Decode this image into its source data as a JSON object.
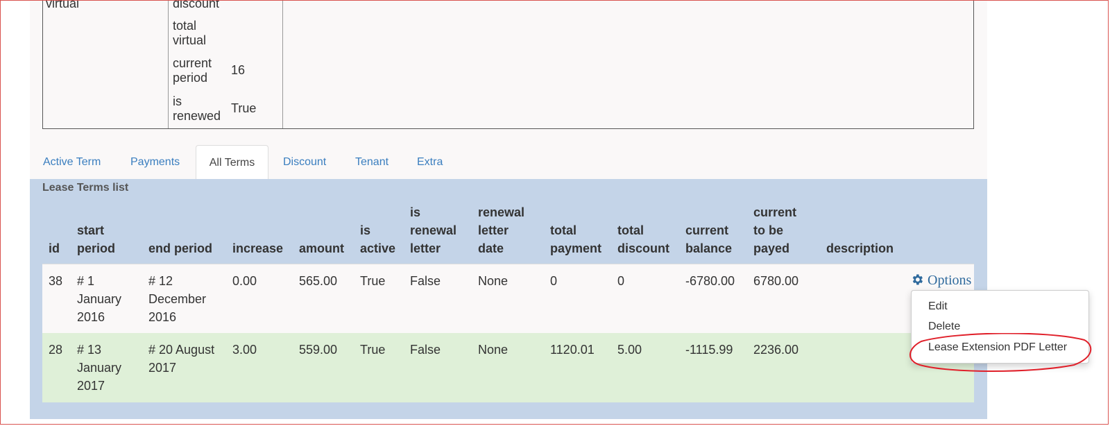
{
  "details": {
    "col1_partial": "virtual",
    "rows": [
      {
        "label": "discount",
        "value": ""
      },
      {
        "label": "total\nvirtual",
        "value": ""
      },
      {
        "label": "current\nperiod",
        "value": "16"
      },
      {
        "label": "is\nrenewed",
        "value": "True"
      }
    ]
  },
  "tabs": [
    "Active Term",
    "Payments",
    "All Terms",
    "Discount",
    "Tenant",
    "Extra"
  ],
  "active_tab": "All Terms",
  "list_title": "Lease Terms list",
  "headers": [
    "id",
    "start\nperiod",
    "end period",
    "increase",
    "amount",
    "is\nactive",
    "is\nrenewal\nletter",
    "renewal\nletter\ndate",
    "total\npayment",
    "total\ndiscount",
    "current\nbalance",
    "current\nto be\npayed",
    "description"
  ],
  "rows": [
    [
      "38",
      "# 1\nJanuary\n2016",
      "# 12\nDecember\n2016",
      "0.00",
      "565.00",
      "True",
      "False",
      "None",
      "0",
      "0",
      "-6780.00",
      "6780.00",
      ""
    ],
    [
      "28",
      "# 13\nJanuary\n2017",
      "# 20 August\n2017",
      "3.00",
      "559.00",
      "True",
      "False",
      "None",
      "1120.01",
      "5.00",
      "-1115.99",
      "2236.00",
      ""
    ]
  ],
  "options_label": "Options",
  "dropdown_items": [
    "Edit",
    "Delete",
    "Lease Extension PDF Letter"
  ],
  "icons": {
    "options": "gear-icon"
  },
  "colors": {
    "link": "#3a7ebf",
    "list_bg": "#c4d4e8",
    "row_highlight": "#dff0d8",
    "annotation": "#e0202a"
  }
}
